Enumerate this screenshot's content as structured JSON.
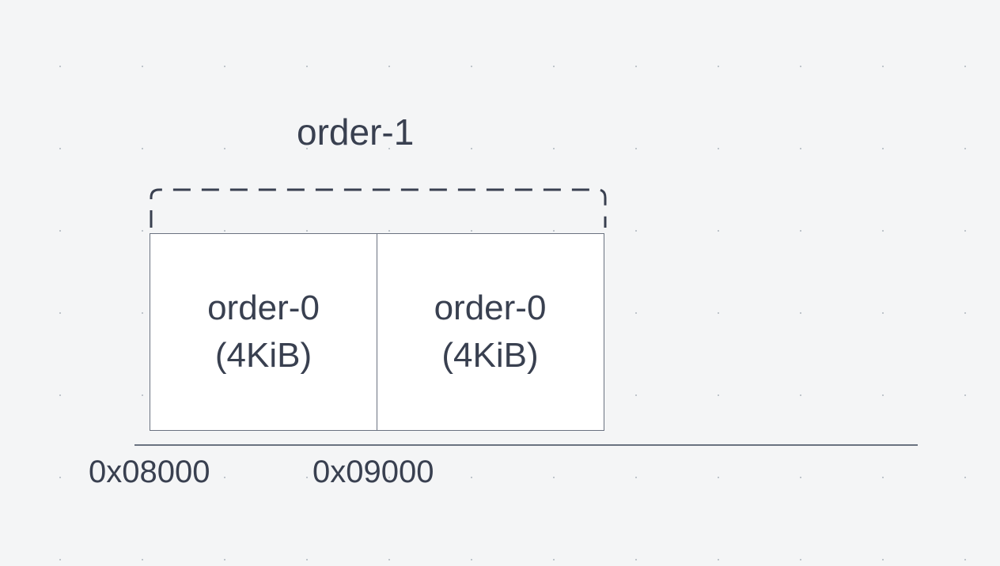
{
  "diagram": {
    "group_label": "order-1",
    "blocks": [
      {
        "title": "order-0",
        "size": "(4KiB)"
      },
      {
        "title": "order-0",
        "size": "(4KiB)"
      }
    ],
    "addresses": [
      "0x08000",
      "0x09000"
    ]
  }
}
